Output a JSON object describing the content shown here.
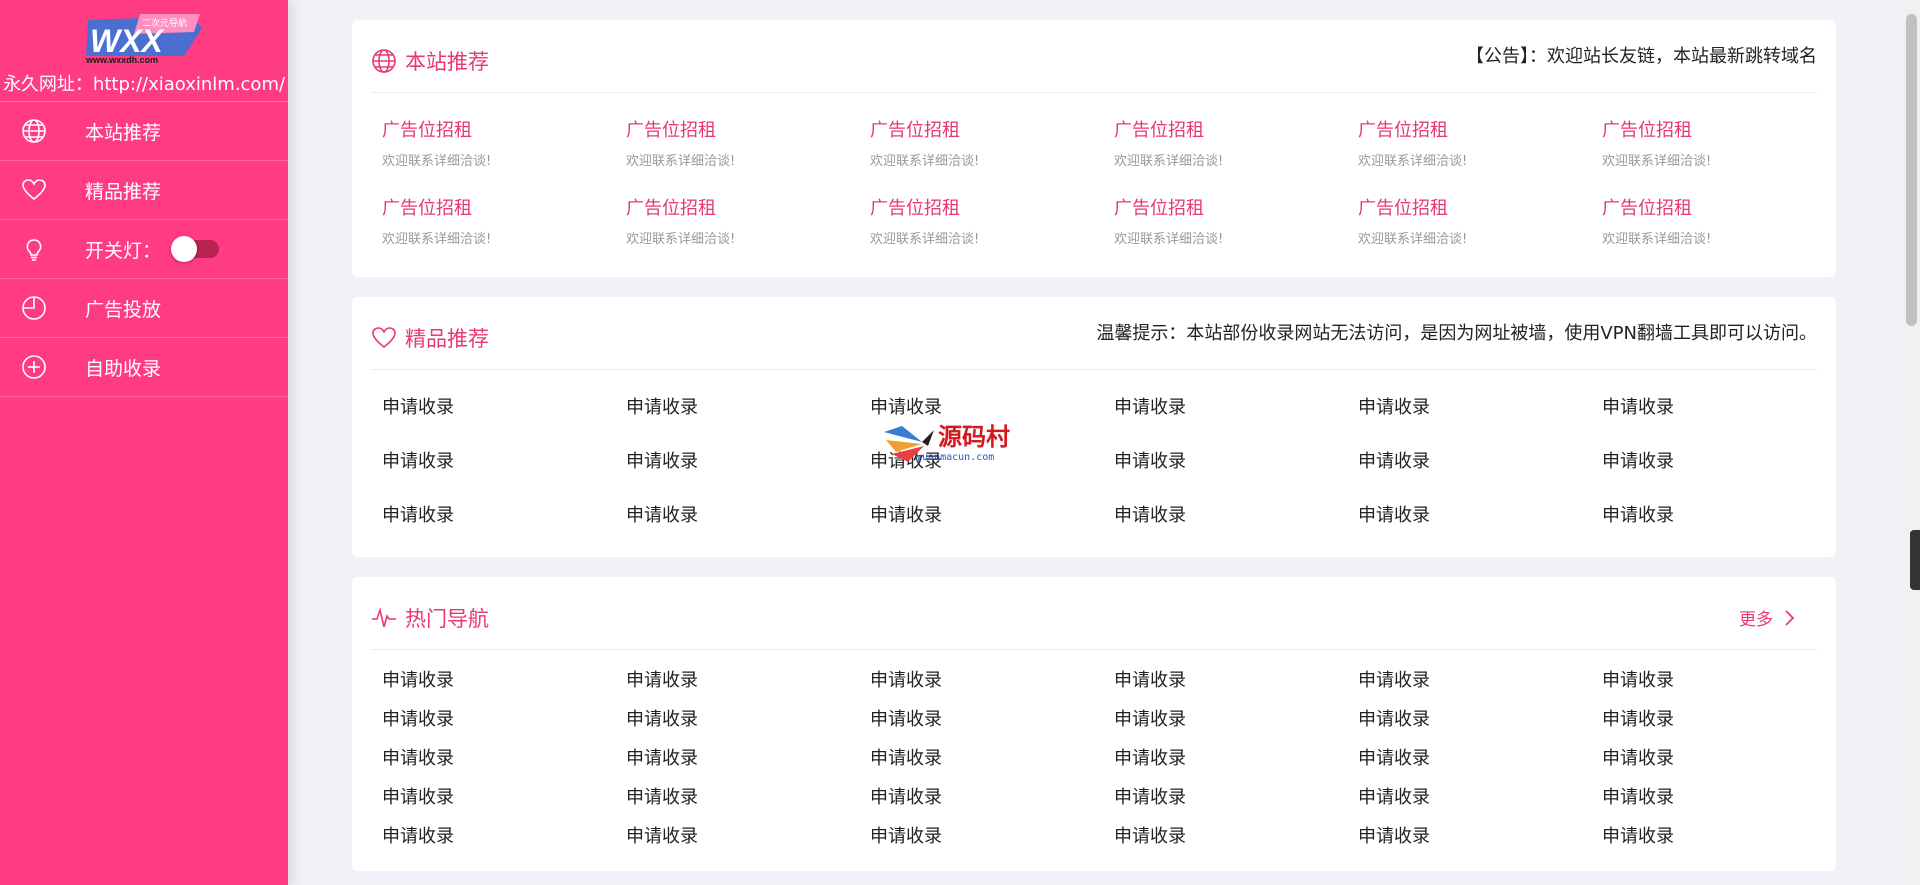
{
  "sidebar": {
    "logo_text": "WXX",
    "logo_badge": "二次元导航",
    "logo_domain": "www.wxxdh.com",
    "permanent_url": "永久网址：http://xiaoxinlm.com/",
    "items": [
      {
        "label": "本站推荐",
        "icon": "globe-icon"
      },
      {
        "label": "精品推荐",
        "icon": "heart-icon"
      },
      {
        "label": "开关灯：",
        "icon": "lightbulb-icon"
      },
      {
        "label": "广告投放",
        "icon": "pie-chart-icon"
      },
      {
        "label": "自助收录",
        "icon": "plus-circle-icon"
      }
    ]
  },
  "sections": {
    "recommend": {
      "title": "本站推荐",
      "notice": "【公告】：欢迎站长友链，本站最新跳转域名",
      "ads": [
        {
          "title": "广告位招租",
          "sub": "欢迎联系详细洽谈!"
        },
        {
          "title": "广告位招租",
          "sub": "欢迎联系详细洽谈!"
        },
        {
          "title": "广告位招租",
          "sub": "欢迎联系详细洽谈!"
        },
        {
          "title": "广告位招租",
          "sub": "欢迎联系详细洽谈!"
        },
        {
          "title": "广告位招租",
          "sub": "欢迎联系详细洽谈!"
        },
        {
          "title": "广告位招租",
          "sub": "欢迎联系详细洽谈!"
        },
        {
          "title": "广告位招租",
          "sub": "欢迎联系详细洽谈!"
        },
        {
          "title": "广告位招租",
          "sub": "欢迎联系详细洽谈!"
        },
        {
          "title": "广告位招租",
          "sub": "欢迎联系详细洽谈!"
        },
        {
          "title": "广告位招租",
          "sub": "欢迎联系详细洽谈!"
        },
        {
          "title": "广告位招租",
          "sub": "欢迎联系详细洽谈!"
        },
        {
          "title": "广告位招租",
          "sub": "欢迎联系详细洽谈!"
        }
      ]
    },
    "featured": {
      "title": "精品推荐",
      "notice": "温馨提示：本站部份收录网站无法访问，是因为网址被墙，使用VPN翻墙工具即可以访问。",
      "links": [
        "申请收录",
        "申请收录",
        "申请收录",
        "申请收录",
        "申请收录",
        "申请收录",
        "申请收录",
        "申请收录",
        "申请收录",
        "申请收录",
        "申请收录",
        "申请收录",
        "申请收录",
        "申请收录",
        "申请收录",
        "申请收录",
        "申请收录",
        "申请收录"
      ]
    },
    "hot": {
      "title": "热门导航",
      "more_label": "更多",
      "links": [
        "申请收录",
        "申请收录",
        "申请收录",
        "申请收录",
        "申请收录",
        "申请收录",
        "申请收录",
        "申请收录",
        "申请收录",
        "申请收录",
        "申请收录",
        "申请收录",
        "申请收录",
        "申请收录",
        "申请收录",
        "申请收录",
        "申请收录",
        "申请收录",
        "申请收录",
        "申请收录",
        "申请收录",
        "申请收录",
        "申请收录",
        "申请收录",
        "申请收录",
        "申请收录",
        "申请收录",
        "申请收录",
        "申请收录",
        "申请收录"
      ]
    }
  },
  "watermark": {
    "title": "源码村",
    "domain": "yuanmacun.com"
  },
  "colors": {
    "sidebar": "#ff3b82",
    "accent": "#e8386f",
    "background": "#f1f1f8"
  }
}
